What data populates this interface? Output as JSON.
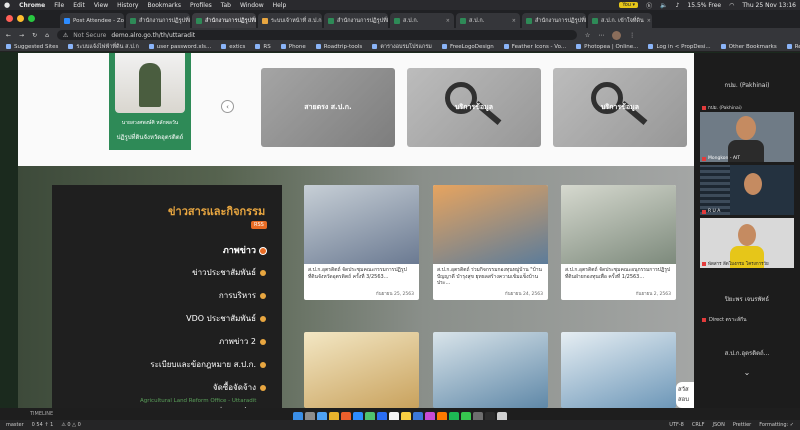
{
  "menubar": {
    "app": "Chrome",
    "items": [
      "File",
      "Edit",
      "View",
      "History",
      "Bookmarks",
      "Profiles",
      "Tab",
      "Window",
      "Help"
    ],
    "zoom_btn": "You ▾",
    "battery": "15.5% Free",
    "clock": "Thu 25 Nov 13:16"
  },
  "tabs": [
    {
      "label": "Post Attendee - Zoom",
      "color": "#2d8cff"
    },
    {
      "label": "สำนักงานการปฏิรูปที่ดิน",
      "color": "#2e8a57"
    },
    {
      "label": "สำนักงานการปฏิรูปที่ดิน",
      "color": "#2e8a57",
      "active": true
    },
    {
      "label": "ระบบเจ้าหน้าที่ ส.ป.ก.",
      "color": "#e8a640"
    },
    {
      "label": "สำนักงานการปฏิรูปที่ดิน",
      "color": "#2e8a57"
    },
    {
      "label": "ส.ป.ก.",
      "color": "#2e8a57"
    },
    {
      "label": "ส.ป.ก.",
      "color": "#2e8a57"
    },
    {
      "label": "สำนักงานการปฏิรูปที่ดิน",
      "color": "#2e8a57"
    },
    {
      "label": "ส.ป.ก. เข้าใจที่ดิน",
      "color": "#2e8a57"
    }
  ],
  "address": {
    "security": "Not Secure",
    "url": "demo.alro.go.th/th/uttaradit"
  },
  "bookmarks": [
    "Suggested Sites",
    "ระบบแจ้งไฟฟ้าที่ดิน ส.ป.ก",
    "user password.xls...",
    "extics",
    "RS",
    "Phone",
    "Roadtrip-tools",
    "ตารางอบรมโปรแกรม",
    "FreeLogoDesign",
    "Feather Icons - Vo...",
    "Photopea | Online...",
    "Log in < PropDesi...",
    "Other Bookmarks",
    "Reading List"
  ],
  "hero": {
    "name_line": "นายสวงศพงษ์ศิ หลักพลวัน",
    "position": "ปฏิรูปที่ดินจังหวัดอุตรดิตถ์",
    "prev": "‹",
    "cards": [
      "สายตรง ส.ป.ก.",
      "บริการข้อมูล",
      "บริการข้อมูล"
    ]
  },
  "news": {
    "title": "ข่าวสารและกิจกรรม",
    "rss": "RSS",
    "categories": [
      {
        "label": "ภาพข่าว",
        "active": true
      },
      {
        "label": "ข่าวประชาสัมพันธ์"
      },
      {
        "label": "การบริหาร"
      },
      {
        "label": "VDO ประชาสัมพันธ์"
      },
      {
        "label": "ภาพข่าว 2"
      },
      {
        "label": "ระเบียบและข้อกฎหมาย ส.ป.ก."
      },
      {
        "label": "จัดซื้อจัดจ้าง"
      },
      {
        "label": "ข่าว ส.ป.ก."
      }
    ],
    "footer": "Agricultural Land Reform Office - Uttaradit",
    "cards": [
      {
        "caption": "ส.ป.ก.อุตรดิตถ์ จัดประชุมคณะกรรมการปฏิรูปที่ดินจังหวัดอุตรดิตถ์ ครั้งที่ 3/2563...",
        "date": "กันยายน 25, 2563"
      },
      {
        "caption": "ส.ป.ก.อุตรดิตถ์ ร่วมกิจกรรมกองทุนหมู่บ้าน \"บ้านปัญญาดี บำรุงสุข ยุทธลสร้างความเข้มแข็งบ้านประ...",
        "date": "กันยายน 24, 2563"
      },
      {
        "caption": "ส.ป.ก.อุตรดิตถ์ จัดประชุมคณะอนุกรรมการปฏิรูปที่ดินฝ่ายกองทุนเพื่อ ครั้งที่ 1/2563...",
        "date": "กันยายน 2, 2563"
      }
    ],
    "side_badge": "สวัส สอบ"
  },
  "zoom": {
    "header": "กปม. (Pakhinai)",
    "tiles": [
      {
        "name": "กปม. (Pakhinai)"
      },
      {
        "name": "Mongkon - AIT"
      },
      {
        "name": "R U A"
      },
      {
        "name": "พัดสาร ลีดโมงกรม โครงการวัย"
      }
    ],
    "label1": "ปิยะพร เจนรพัทธ์",
    "sub1": "Direct ตราะส์กีน",
    "label2": "ส.ป.ก.อุตรดิตถ์...",
    "chevron": "⌄"
  },
  "statusbar": {
    "timeline": "TIMELINE",
    "branch": "master",
    "items": [
      "0 54 ↑ 1",
      "⚠ 0 △ 0"
    ],
    "right": [
      "UTF-8",
      "CRLF",
      "JSON",
      "Prettier",
      "Formatting: ✓"
    ]
  }
}
